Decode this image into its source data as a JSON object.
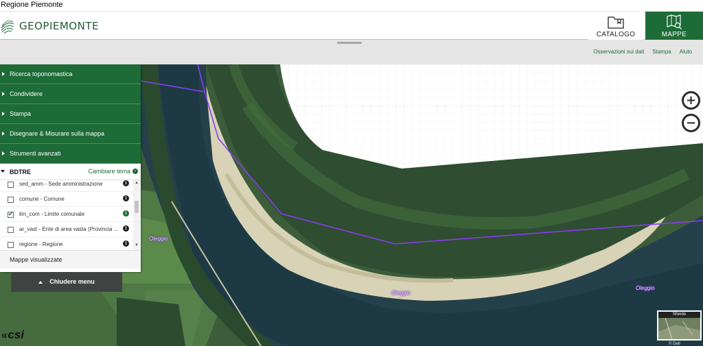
{
  "site_title": "Regione Piemonte",
  "header": {
    "logo_text": "GEOPIEMONTE",
    "catalogo_label": "CATALOGO",
    "mappe_label": "MAPPE"
  },
  "toolbar": {
    "links": [
      "Osservazioni sui dati",
      "Stampa",
      "Aiuto"
    ]
  },
  "menu": {
    "items": [
      "Ricerca toponomastica",
      "Condividere",
      "Stampa",
      "Disegnare & Misurare sulla mappa",
      "Strumenti avanzati"
    ],
    "theme": {
      "name": "BDTRE",
      "change_label": "Cambiare tema"
    },
    "layers": [
      {
        "name": "sed_amm - Sede amministrazione",
        "checked": false
      },
      {
        "name": "comune - Comune",
        "checked": false
      },
      {
        "name": "lim_com - Limite comunale",
        "checked": true
      },
      {
        "name": "ar_vast - Ente di area vasta (Provincia ...",
        "checked": false
      },
      {
        "name": "regione - Regione",
        "checked": false
      }
    ],
    "mappe_visualizzate": "Mappe visualizzate",
    "close_label": "Chiudere menu"
  },
  "map": {
    "place_labels": [
      "Oleggio",
      "Oleggio",
      "Oleggio"
    ],
    "basemap_title": "Sfondo",
    "credit": "© Dati",
    "brand": "csi",
    "zoom_in": "+",
    "zoom_out": "−",
    "boundary_color": "#8a3cf0",
    "accent": "#1d6b36"
  }
}
